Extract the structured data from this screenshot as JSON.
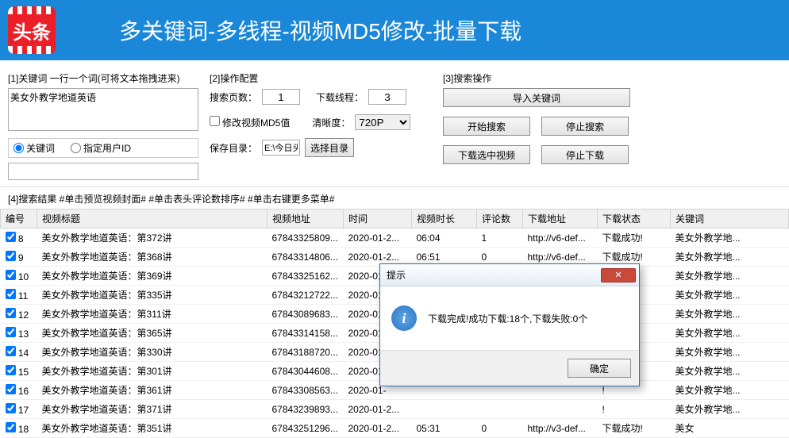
{
  "header": {
    "logo_text": "头条",
    "title": "多关键词-多线程-视频MD5修改-批量下载"
  },
  "sec1": {
    "label": "[1]关键词 一行一个词(可将文本拖拽进来)",
    "keywords_value": "美女外教学地道英语",
    "radio_keyword": "关键词",
    "radio_userid": "指定用户ID"
  },
  "sec2": {
    "label": "[2]操作配置",
    "pages_label": "搜索页数：",
    "pages_value": "1",
    "threads_label": "下载线程：",
    "threads_value": "3",
    "md5_label": "修改视频MD5值",
    "clarity_label": "清晰度：",
    "clarity_value": "720P",
    "save_label": "保存目录：",
    "save_value": "E:\\今日头条视频下载器\\",
    "choose_dir": "选择目录"
  },
  "sec3": {
    "label": "[3]搜索操作",
    "import": "导入关键词",
    "start_search": "开始搜索",
    "stop_search": "停止搜索",
    "dl_selected": "下载选中视频",
    "stop_dl": "停止下载"
  },
  "result_label": "[4]搜索结果 #单击预览视频封面#  #单击表头评论数排序#  #单击右键更多菜单#",
  "columns": {
    "idx": "编号",
    "title": "视频标题",
    "addr": "视频地址",
    "time": "时间",
    "dur": "视频时长",
    "cmt": "评论数",
    "dl": "下载地址",
    "st": "下载状态",
    "kw": "关键词"
  },
  "rows": [
    {
      "idx": "8",
      "title": "美女外教学地道英语：第372讲",
      "addr": "67843325809...",
      "time": "2020-01-2...",
      "dur": "06:04",
      "cmt": "1",
      "dl": "http://v6-def...",
      "st": "下载成功!",
      "kw": "美女外教学地..."
    },
    {
      "idx": "9",
      "title": "美女外教学地道英语：第368讲",
      "addr": "67843314806...",
      "time": "2020-01-2...",
      "dur": "06:51",
      "cmt": "0",
      "dl": "http://v6-def...",
      "st": "下载成功!",
      "kw": "美女外教学地..."
    },
    {
      "idx": "10",
      "title": "美女外教学地道英语：第369讲",
      "addr": "67843325162...",
      "time": "2020-01-",
      "dur": "",
      "cmt": "",
      "dl": "",
      "st": "!",
      "kw": "美女外教学地..."
    },
    {
      "idx": "11",
      "title": "美女外教学地道英语：第335讲",
      "addr": "67843212722...",
      "time": "2020-01-",
      "dur": "",
      "cmt": "",
      "dl": "",
      "st": "!",
      "kw": "美女外教学地..."
    },
    {
      "idx": "12",
      "title": "美女外教学地道英语：第311讲",
      "addr": "67843089683...",
      "time": "2020-01-",
      "dur": "",
      "cmt": "",
      "dl": "",
      "st": "!",
      "kw": "美女外教学地..."
    },
    {
      "idx": "13",
      "title": "美女外教学地道英语：第365讲",
      "addr": "67843314158...",
      "time": "2020-01-",
      "dur": "",
      "cmt": "",
      "dl": "",
      "st": "!",
      "kw": "美女外教学地..."
    },
    {
      "idx": "14",
      "title": "美女外教学地道英语：第330讲",
      "addr": "67843188720...",
      "time": "2020-01-",
      "dur": "",
      "cmt": "",
      "dl": "",
      "st": "!",
      "kw": "美女外教学地..."
    },
    {
      "idx": "15",
      "title": "美女外教学地道英语：第301讲",
      "addr": "67843044608...",
      "time": "2020-01-",
      "dur": "",
      "cmt": "",
      "dl": "",
      "st": "!",
      "kw": "美女外教学地..."
    },
    {
      "idx": "16",
      "title": "美女外教学地道英语：第361讲",
      "addr": "67843308563...",
      "time": "2020-01-",
      "dur": "",
      "cmt": "",
      "dl": "",
      "st": "!",
      "kw": "美女外教学地..."
    },
    {
      "idx": "17",
      "title": "美女外教学地道英语：第371讲",
      "addr": "67843239893...",
      "time": "2020-01-2...",
      "dur": "",
      "cmt": "",
      "dl": "",
      "st": "!",
      "kw": "美女外教学地..."
    },
    {
      "idx": "18",
      "title": "美女外教学地道英语：第351讲",
      "addr": "67843251296...",
      "time": "2020-01-2...",
      "dur": "05:31",
      "cmt": "0",
      "dl": "http://v3-def...",
      "st": "下载成功!",
      "kw": "美女"
    }
  ],
  "dialog": {
    "title": "提示",
    "message": "下载完成!成功下载:18个,下载失败:0个",
    "ok": "确定"
  }
}
